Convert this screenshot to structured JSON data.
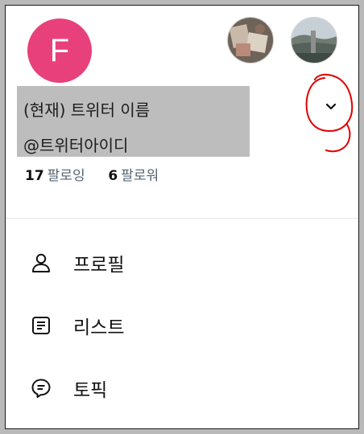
{
  "profile": {
    "avatar_letter": "F",
    "avatar_color": "#e8407a",
    "display_name": "(현재) 트위터 이름",
    "handle": "@트위터아이디",
    "following_count": "17",
    "following_label": "팔로잉",
    "followers_count": "6",
    "followers_label": "팔로워"
  },
  "account_switcher": {
    "other_accounts": [
      "account-photo-1",
      "account-photo-2"
    ],
    "expand_icon": "chevron-down-icon"
  },
  "annotation": {
    "color": "#e00000",
    "shape": "hand-drawn-circle"
  },
  "menu": {
    "items": [
      {
        "label": "프로필",
        "icon": "person-icon"
      },
      {
        "label": "리스트",
        "icon": "list-icon"
      },
      {
        "label": "토픽",
        "icon": "topic-icon"
      }
    ]
  }
}
